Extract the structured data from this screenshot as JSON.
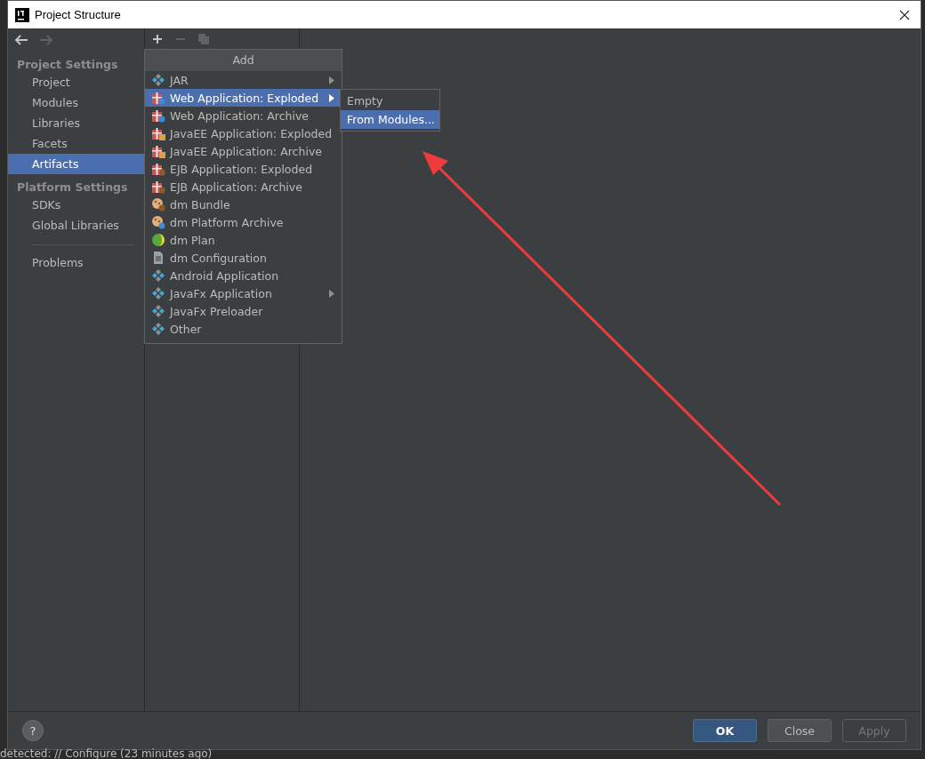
{
  "window": {
    "title": "Project Structure"
  },
  "nav": [
    {
      "kind": "back",
      "disabled": false
    },
    {
      "kind": "forward",
      "disabled": true
    }
  ],
  "sidebar": [
    {
      "heading": "Project Settings",
      "items": [
        {
          "label": "Project",
          "selected": false
        },
        {
          "label": "Modules",
          "selected": false
        },
        {
          "label": "Libraries",
          "selected": false
        },
        {
          "label": "Facets",
          "selected": false
        },
        {
          "label": "Artifacts",
          "selected": true
        }
      ]
    },
    {
      "heading": "Platform Settings",
      "items": [
        {
          "label": "SDKs",
          "selected": false
        },
        {
          "label": "Global Libraries",
          "selected": false
        }
      ]
    },
    {
      "items": [
        {
          "label": "Problems",
          "selected": false
        }
      ]
    }
  ],
  "toolbar": [
    {
      "kind": "add",
      "disabled": false
    },
    {
      "kind": "remove",
      "disabled": true
    },
    {
      "kind": "copy",
      "disabled": true
    }
  ],
  "add_menu": {
    "title": "Add",
    "items": [
      {
        "label": "JAR",
        "kind": "diamond",
        "submenu": true,
        "selected": false
      },
      {
        "label": "Web Application: Exploded",
        "kind": "gift-web",
        "submenu": true,
        "selected": true
      },
      {
        "label": "Web Application: Archive",
        "kind": "gift-web",
        "submenu": false,
        "selected": false
      },
      {
        "label": "JavaEE Application: Exploded",
        "kind": "gift-ee",
        "submenu": false,
        "selected": false
      },
      {
        "label": "JavaEE Application: Archive",
        "kind": "gift-ee",
        "submenu": false,
        "selected": false
      },
      {
        "label": "EJB Application: Exploded",
        "kind": "gift-ejb",
        "submenu": false,
        "selected": false
      },
      {
        "label": "EJB Application: Archive",
        "kind": "gift-ejb",
        "submenu": false,
        "selected": false
      },
      {
        "label": "dm Bundle",
        "kind": "bundle",
        "submenu": false,
        "selected": false
      },
      {
        "label": "dm Platform Archive",
        "kind": "bundle-lock",
        "submenu": false,
        "selected": false
      },
      {
        "label": "dm Plan",
        "kind": "globe",
        "submenu": false,
        "selected": false
      },
      {
        "label": "dm Configuration",
        "kind": "document",
        "submenu": false,
        "selected": false
      },
      {
        "label": "Android Application",
        "kind": "diamond",
        "submenu": false,
        "selected": false
      },
      {
        "label": "JavaFx Application",
        "kind": "diamond",
        "submenu": true,
        "selected": false
      },
      {
        "label": "JavaFx Preloader",
        "kind": "diamond",
        "submenu": false,
        "selected": false
      },
      {
        "label": "Other",
        "kind": "diamond",
        "submenu": false,
        "selected": false
      }
    ]
  },
  "submenu": [
    {
      "label": "Empty",
      "selected": false
    },
    {
      "label": "From Modules...",
      "selected": true
    }
  ],
  "help": "?",
  "buttons": [
    {
      "label": "OK",
      "kind": "default",
      "disabled": false
    },
    {
      "label": "Close",
      "kind": "normal",
      "disabled": false
    },
    {
      "label": "Apply",
      "kind": "normal",
      "disabled": true
    }
  ],
  "background_status": "detected: // Configure (23 minutes ago)"
}
